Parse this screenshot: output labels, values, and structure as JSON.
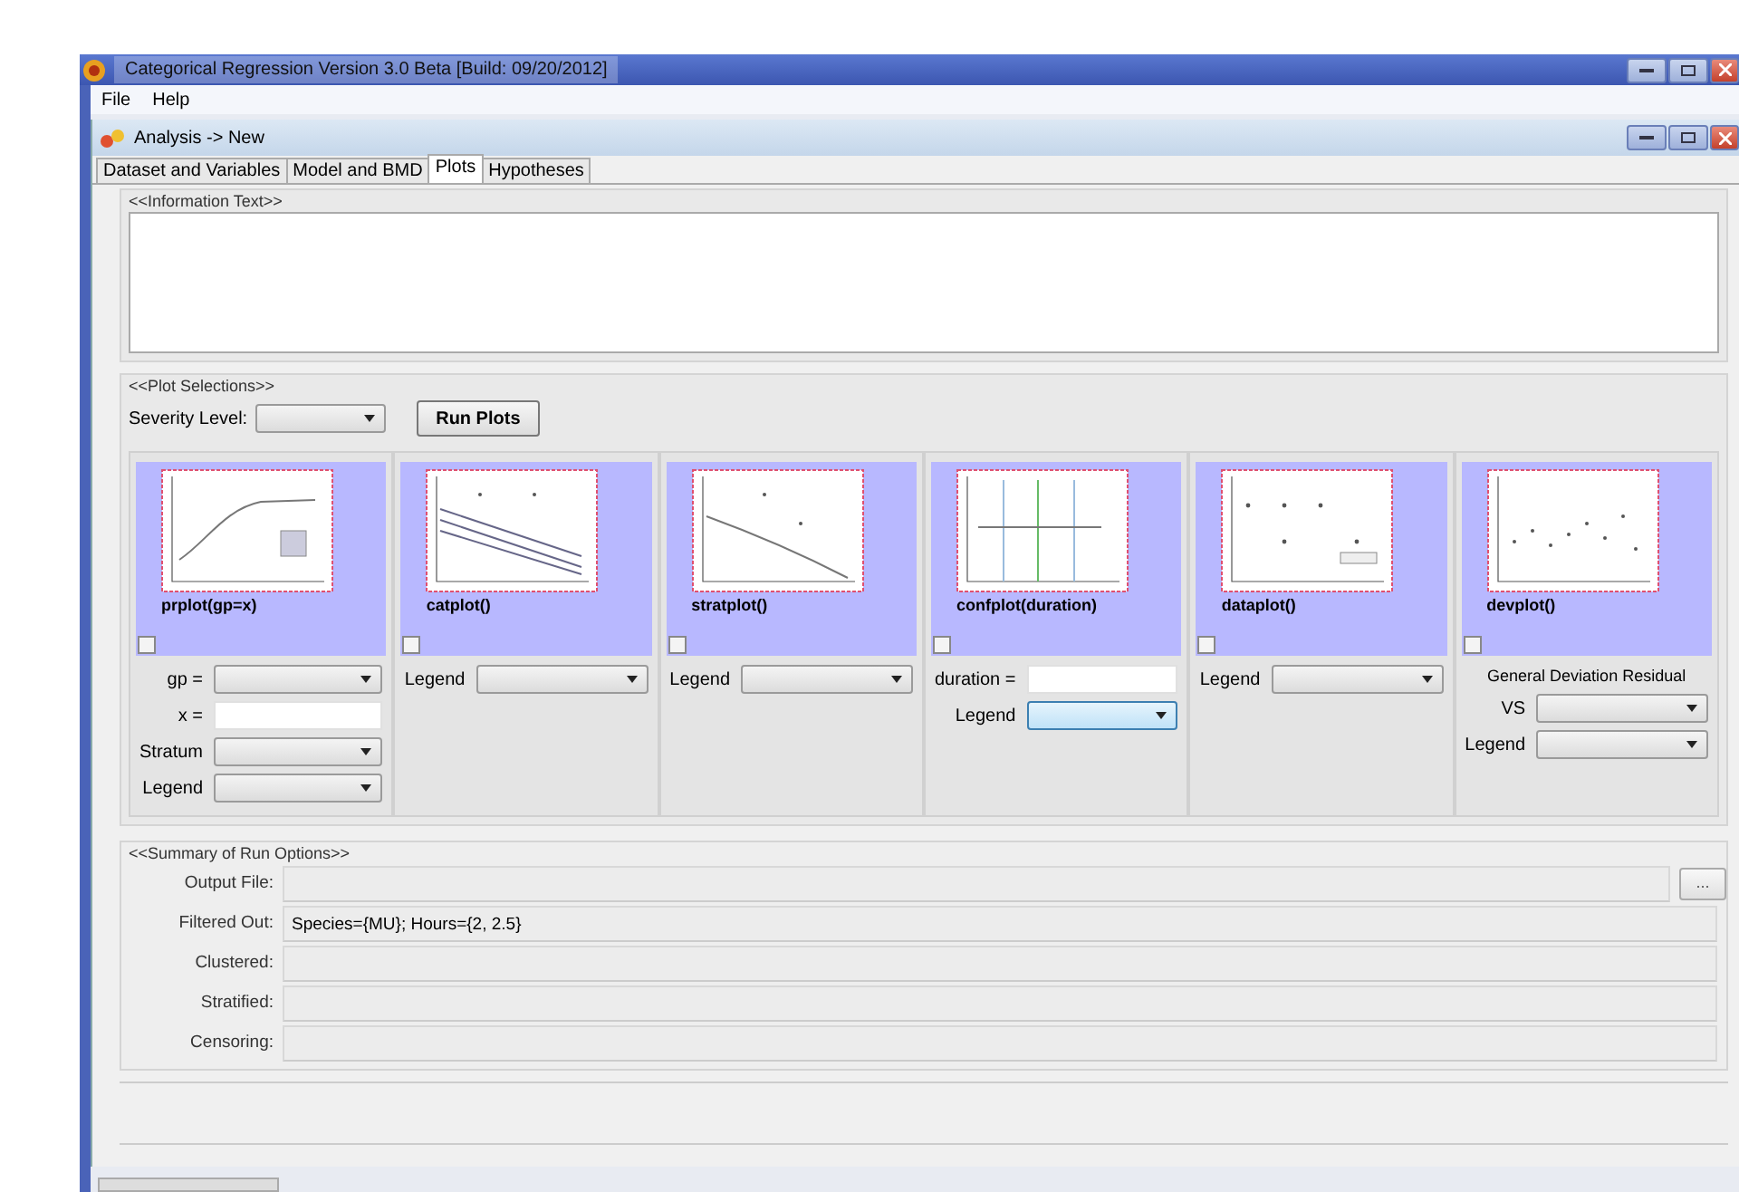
{
  "window": {
    "title": "Categorical Regression Version 3.0 Beta [Build: 09/20/2012]"
  },
  "menu": [
    "File",
    "Help"
  ],
  "document": {
    "title": "Analysis -> New"
  },
  "tabs": [
    {
      "label": "Dataset and Variables",
      "selected": false
    },
    {
      "label": "Model and BMD",
      "selected": false
    },
    {
      "label": "Plots",
      "selected": true
    },
    {
      "label": "Hypotheses",
      "selected": false
    }
  ],
  "information": {
    "heading": "<<Information Text>>"
  },
  "plot_selections": {
    "heading": "<<Plot Selections>>",
    "severity_label": "Severity Level:",
    "run_button": "Run Plots",
    "plots": [
      {
        "name": "prplot(gp=x)",
        "checked": false,
        "controls": [
          {
            "kind": "select",
            "label": "gp =",
            "focused": false
          },
          {
            "kind": "input",
            "label": "x ="
          },
          {
            "kind": "select",
            "label": "Stratum",
            "focused": false
          },
          {
            "kind": "select",
            "label": "Legend",
            "focused": false
          }
        ]
      },
      {
        "name": "catplot()",
        "checked": false,
        "controls": [
          {
            "kind": "select",
            "label": "Legend",
            "focused": false
          }
        ]
      },
      {
        "name": "stratplot()",
        "checked": false,
        "controls": [
          {
            "kind": "select",
            "label": "Legend",
            "focused": false
          }
        ]
      },
      {
        "name": "confplot(duration)",
        "checked": false,
        "controls": [
          {
            "kind": "input",
            "label": "duration ="
          },
          {
            "kind": "select",
            "label": "Legend",
            "focused": true
          }
        ]
      },
      {
        "name": "dataplot()",
        "checked": false,
        "controls": [
          {
            "kind": "select",
            "label": "Legend",
            "focused": false
          }
        ]
      },
      {
        "name": "devplot()",
        "checked": false,
        "controls": [
          {
            "kind": "text",
            "label": "General Deviation Residual"
          },
          {
            "kind": "select",
            "label": "VS",
            "focused": false
          },
          {
            "kind": "select",
            "label": "Legend",
            "focused": false
          }
        ]
      }
    ]
  },
  "summary": {
    "heading": "<<Summary of Run Options>>",
    "browse_button": "...",
    "rows": [
      {
        "label": "Output File:"
      },
      {
        "label": "Filtered Out:",
        "value": "Species={MU}; Hours={2, 2.5}"
      },
      {
        "label": "Clustered:"
      },
      {
        "label": "Stratified:"
      },
      {
        "label": "Censoring:"
      }
    ]
  }
}
